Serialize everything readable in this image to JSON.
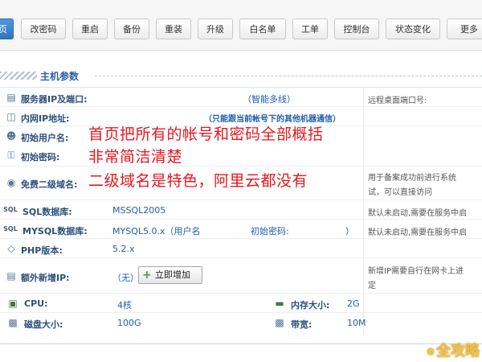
{
  "toolbar": {
    "buttons": [
      "页",
      "改密码",
      "重启",
      "备份",
      "重装",
      "升级",
      "白名单",
      "工单",
      "控制台",
      "状态变化",
      "更多"
    ]
  },
  "section": {
    "title": "主机参数"
  },
  "rows": {
    "server_ip": {
      "label": "服务器IP及端口:",
      "value": "（智能多线）",
      "right": "远程桌面端口号:"
    },
    "internal_ip": {
      "label": "内网IP地址:",
      "value": "（只能跟当前帐号下的其他机器通信）"
    },
    "init_user": {
      "label": "初始用户名:"
    },
    "init_pass": {
      "label": "初始密码:"
    },
    "domain": {
      "label": "免费二级域名:",
      "note1": "用于备案成功前进行系统",
      "note2": "试，可以直接访问"
    },
    "sql": {
      "label": "SQL数据库:",
      "value": "MSSQL2005",
      "note": "默认未启动,需要在服务中启"
    },
    "mysql": {
      "label": "MYSQL数据库:",
      "value": "MYSQL5.0.x（用户名",
      "pass_label": "初始密码:",
      "paren": "）",
      "note": "默认未启动,需要在服务中启"
    },
    "php": {
      "label": "PHP版本:",
      "value": "5.2.x"
    },
    "extra_ip": {
      "label": "额外新增IP:",
      "value": "（无）",
      "button": "立即增加",
      "note1": "新增IP需要自行在网卡上进",
      "note2": "定"
    },
    "cpu": {
      "label": "CPU:",
      "value": "4核",
      "mem_label": "内存大小:",
      "mem_value": "2G"
    },
    "disk": {
      "label": "磁盘大小:",
      "value": "100G",
      "bw_label": "带宽:",
      "bw_value": "10M"
    }
  },
  "overlay": {
    "line1": "首页把所有的帐号和密码全部概括",
    "line2": "非常简洁清楚",
    "line3": "二级域名是特色，阿里云都没有"
  },
  "watermark": "全攻略"
}
